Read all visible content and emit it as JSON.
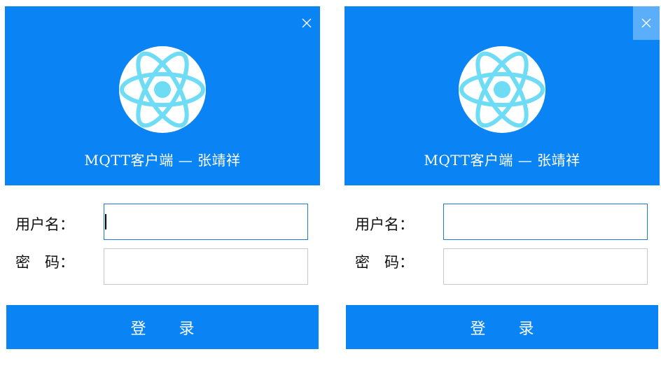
{
  "windows": [
    {
      "state": "login focused field",
      "title": "MQTT客户端 — 张靖祥",
      "close_icon": "close-icon",
      "logo_icon": "atom-icon",
      "username_label": "用户名：",
      "password_label": "密　码：",
      "username_value": "",
      "password_value": "",
      "login_label": "登 录"
    },
    {
      "state": "close button hovered",
      "title": "MQTT客户端 — 张靖祥",
      "close_icon": "close-icon",
      "logo_icon": "atom-icon",
      "username_label": "用户名：",
      "password_label": "密　码：",
      "username_value": "",
      "password_value": "",
      "login_label": "登 录"
    }
  ],
  "colors": {
    "primary": "#0a84f4",
    "close_hover": "#5aaefa",
    "logo_ring": "#6fdcf5",
    "focus_border": "#1e78d8"
  }
}
